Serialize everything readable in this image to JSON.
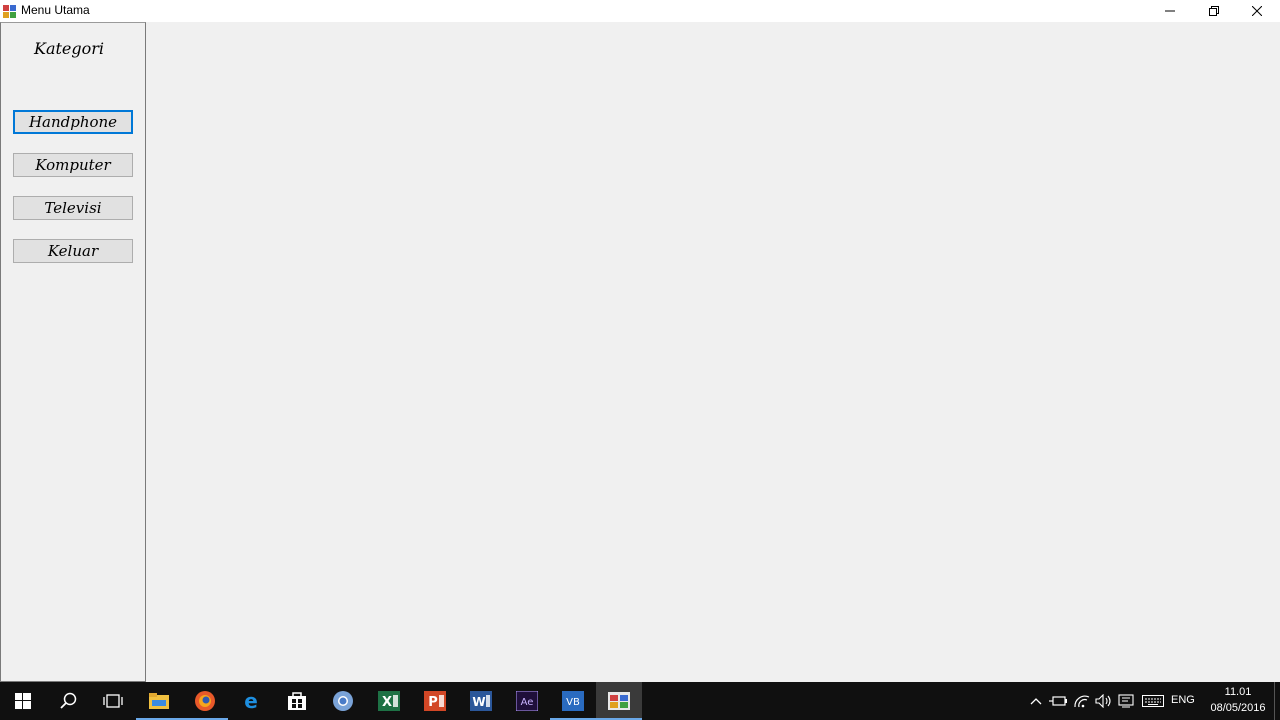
{
  "window": {
    "title": "Menu Utama"
  },
  "sidebar": {
    "title": "Kategori",
    "buttons": [
      {
        "label": "Handphone"
      },
      {
        "label": "Komputer"
      },
      {
        "label": "Televisi"
      },
      {
        "label": "Keluar"
      }
    ]
  },
  "taskbar": {
    "apps": [
      "start-icon",
      "search-icon",
      "task-view-icon",
      "file-explorer-icon",
      "firefox-icon",
      "edge-icon",
      "store-icon",
      "chrome-icon",
      "excel-icon",
      "powerpoint-icon",
      "word-icon",
      "after-effects-icon",
      "visual-studio-icon",
      "winforms-app-icon"
    ],
    "language": "ENG",
    "time": "11.01",
    "date": "08/05/2016"
  },
  "colors": {
    "focus_border": "#0078d7",
    "taskbar_bg": "#101010",
    "window_bg": "#f0f0f0"
  }
}
